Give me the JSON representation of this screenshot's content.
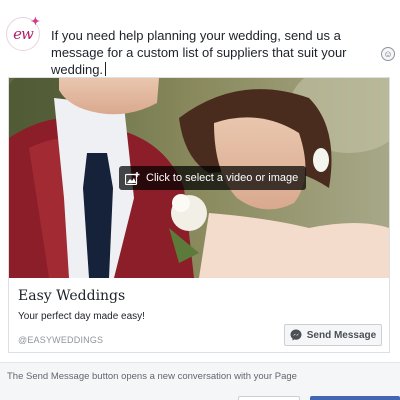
{
  "composer": {
    "avatar_text": "ew",
    "avatar_icon": "ew-logo",
    "message": "If you need help planning your wedding, send us a message for a custom list of suppliers that suit your wedding.",
    "emoji_icon": "smiley-icon"
  },
  "preview": {
    "select_media_label": "Click to select a video or image",
    "select_media_icon": "add-photo-icon",
    "title": "Easy Weddings",
    "description": "Your perfect day made easy!",
    "domain": "@EASYWEDDINGS",
    "cta_label": "Send Message",
    "cta_icon": "messenger-icon"
  },
  "footer": {
    "note": "The Send Message button opens a new conversation with your Page"
  },
  "colors": {
    "brand_pink": "#b21f66",
    "facebook_blue": "#4267b2",
    "text": "#1d2129",
    "muted": "#90949c"
  }
}
